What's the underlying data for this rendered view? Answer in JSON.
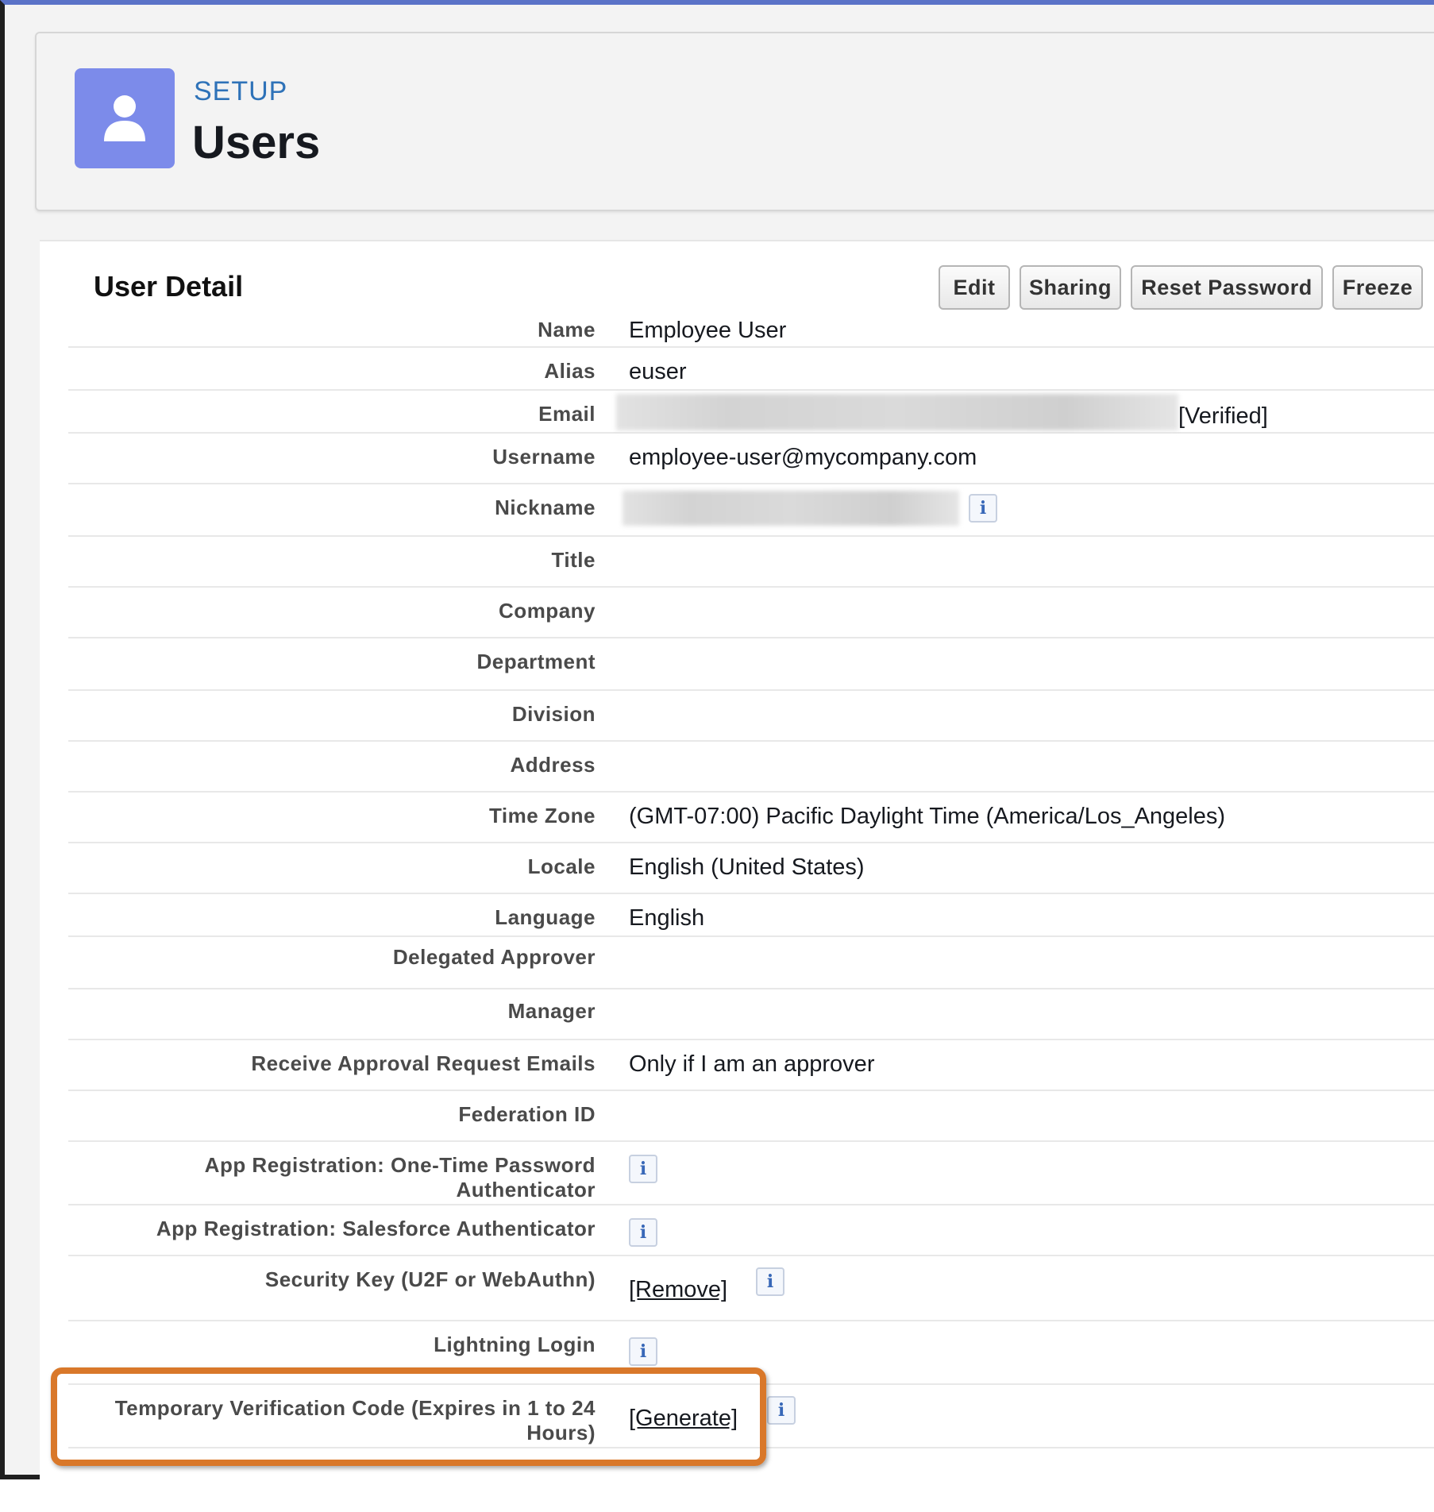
{
  "header": {
    "kicker": "SETUP",
    "title": "Users",
    "icon": "user-icon",
    "icon_bg": "#7c8bea",
    "kicker_color": "#2e72b8"
  },
  "detail": {
    "title": "User Detail",
    "buttons": {
      "edit": "Edit",
      "sharing": "Sharing",
      "reset_password": "Reset Password",
      "freeze": "Freeze"
    },
    "fields": {
      "name": {
        "label": "Name",
        "value": "Employee User"
      },
      "alias": {
        "label": "Alias",
        "value": "euser"
      },
      "email": {
        "label": "Email",
        "value": "[Verified]"
      },
      "username": {
        "label": "Username",
        "value": "employee-user@mycompany.com"
      },
      "nickname": {
        "label": "Nickname"
      },
      "title": {
        "label": "Title"
      },
      "company": {
        "label": "Company"
      },
      "department": {
        "label": "Department"
      },
      "division": {
        "label": "Division"
      },
      "address": {
        "label": "Address"
      },
      "time_zone": {
        "label": "Time Zone",
        "value": "(GMT-07:00) Pacific Daylight Time (America/Los_Angeles)"
      },
      "locale": {
        "label": "Locale",
        "value": "English (United States)"
      },
      "language": {
        "label": "Language",
        "value": "English"
      },
      "delegated_approver": {
        "label": "Delegated Approver"
      },
      "manager": {
        "label": "Manager"
      },
      "receive_approval": {
        "label": "Receive Approval Request Emails",
        "value": "Only if I am an approver"
      },
      "federation_id": {
        "label": "Federation ID"
      },
      "otp_authenticator": {
        "label": "App Registration: One-Time Password Authenticator"
      },
      "sf_authenticator": {
        "label": "App Registration: Salesforce Authenticator"
      },
      "security_key": {
        "label": "Security Key (U2F or WebAuthn)",
        "link": "[Remove]"
      },
      "lightning_login": {
        "label": "Lightning Login"
      },
      "temp_code": {
        "label": "Temporary Verification Code (Expires in 1 to 24 Hours)",
        "link": "[Generate]"
      }
    },
    "info_glyph": "i"
  },
  "highlight_color": "#d9782a"
}
